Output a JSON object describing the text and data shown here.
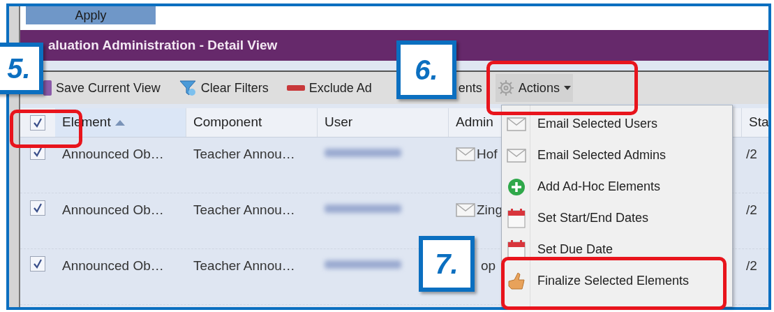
{
  "apply_button": {
    "label": "Apply"
  },
  "panel": {
    "title": "aluation Administration - Detail View"
  },
  "toolbar": [
    {
      "kind": "save",
      "label": "Save Current View"
    },
    {
      "kind": "clear",
      "label": "Clear Filters"
    },
    {
      "kind": "exclude",
      "label": "Exclude Ad",
      "label_tail": "ents"
    },
    {
      "kind": "actions",
      "label": "Actions"
    }
  ],
  "table": {
    "select_all_checked": true,
    "columns": [
      {
        "label": "Element",
        "sorted": true
      },
      {
        "label": "Component",
        "sorted": false
      },
      {
        "label": "User",
        "sorted": false
      },
      {
        "label": "Admin",
        "sorted": false
      },
      {
        "label": "Sta",
        "sorted": false
      }
    ],
    "rows": [
      {
        "checked": true,
        "element": "Announced Ob…",
        "component": "Teacher Annou…",
        "admin": "Hof",
        "admin_mail": true,
        "start": "/2"
      },
      {
        "checked": true,
        "element": "Announced Ob…",
        "component": "Teacher Annou…",
        "admin": "Zing",
        "admin_mail": true,
        "start": "/2"
      },
      {
        "checked": true,
        "element": "Announced Ob…",
        "component": "Teacher Annou…",
        "admin": "op",
        "admin_mail": false,
        "start": "/2"
      }
    ]
  },
  "actions_menu": [
    {
      "kind": "mail",
      "label": "Email Selected Users"
    },
    {
      "kind": "mail",
      "label": "Email Selected Admins"
    },
    {
      "kind": "add",
      "label": "Add Ad-Hoc Elements"
    },
    {
      "kind": "calendar",
      "label": "Set Start/End Dates"
    },
    {
      "kind": "calendar",
      "label": "Set Due Date"
    },
    {
      "kind": "finalize",
      "label": "Finalize Selected Elements"
    }
  ],
  "callouts": [
    {
      "label": "5."
    },
    {
      "label": "6."
    },
    {
      "label": "7."
    }
  ]
}
